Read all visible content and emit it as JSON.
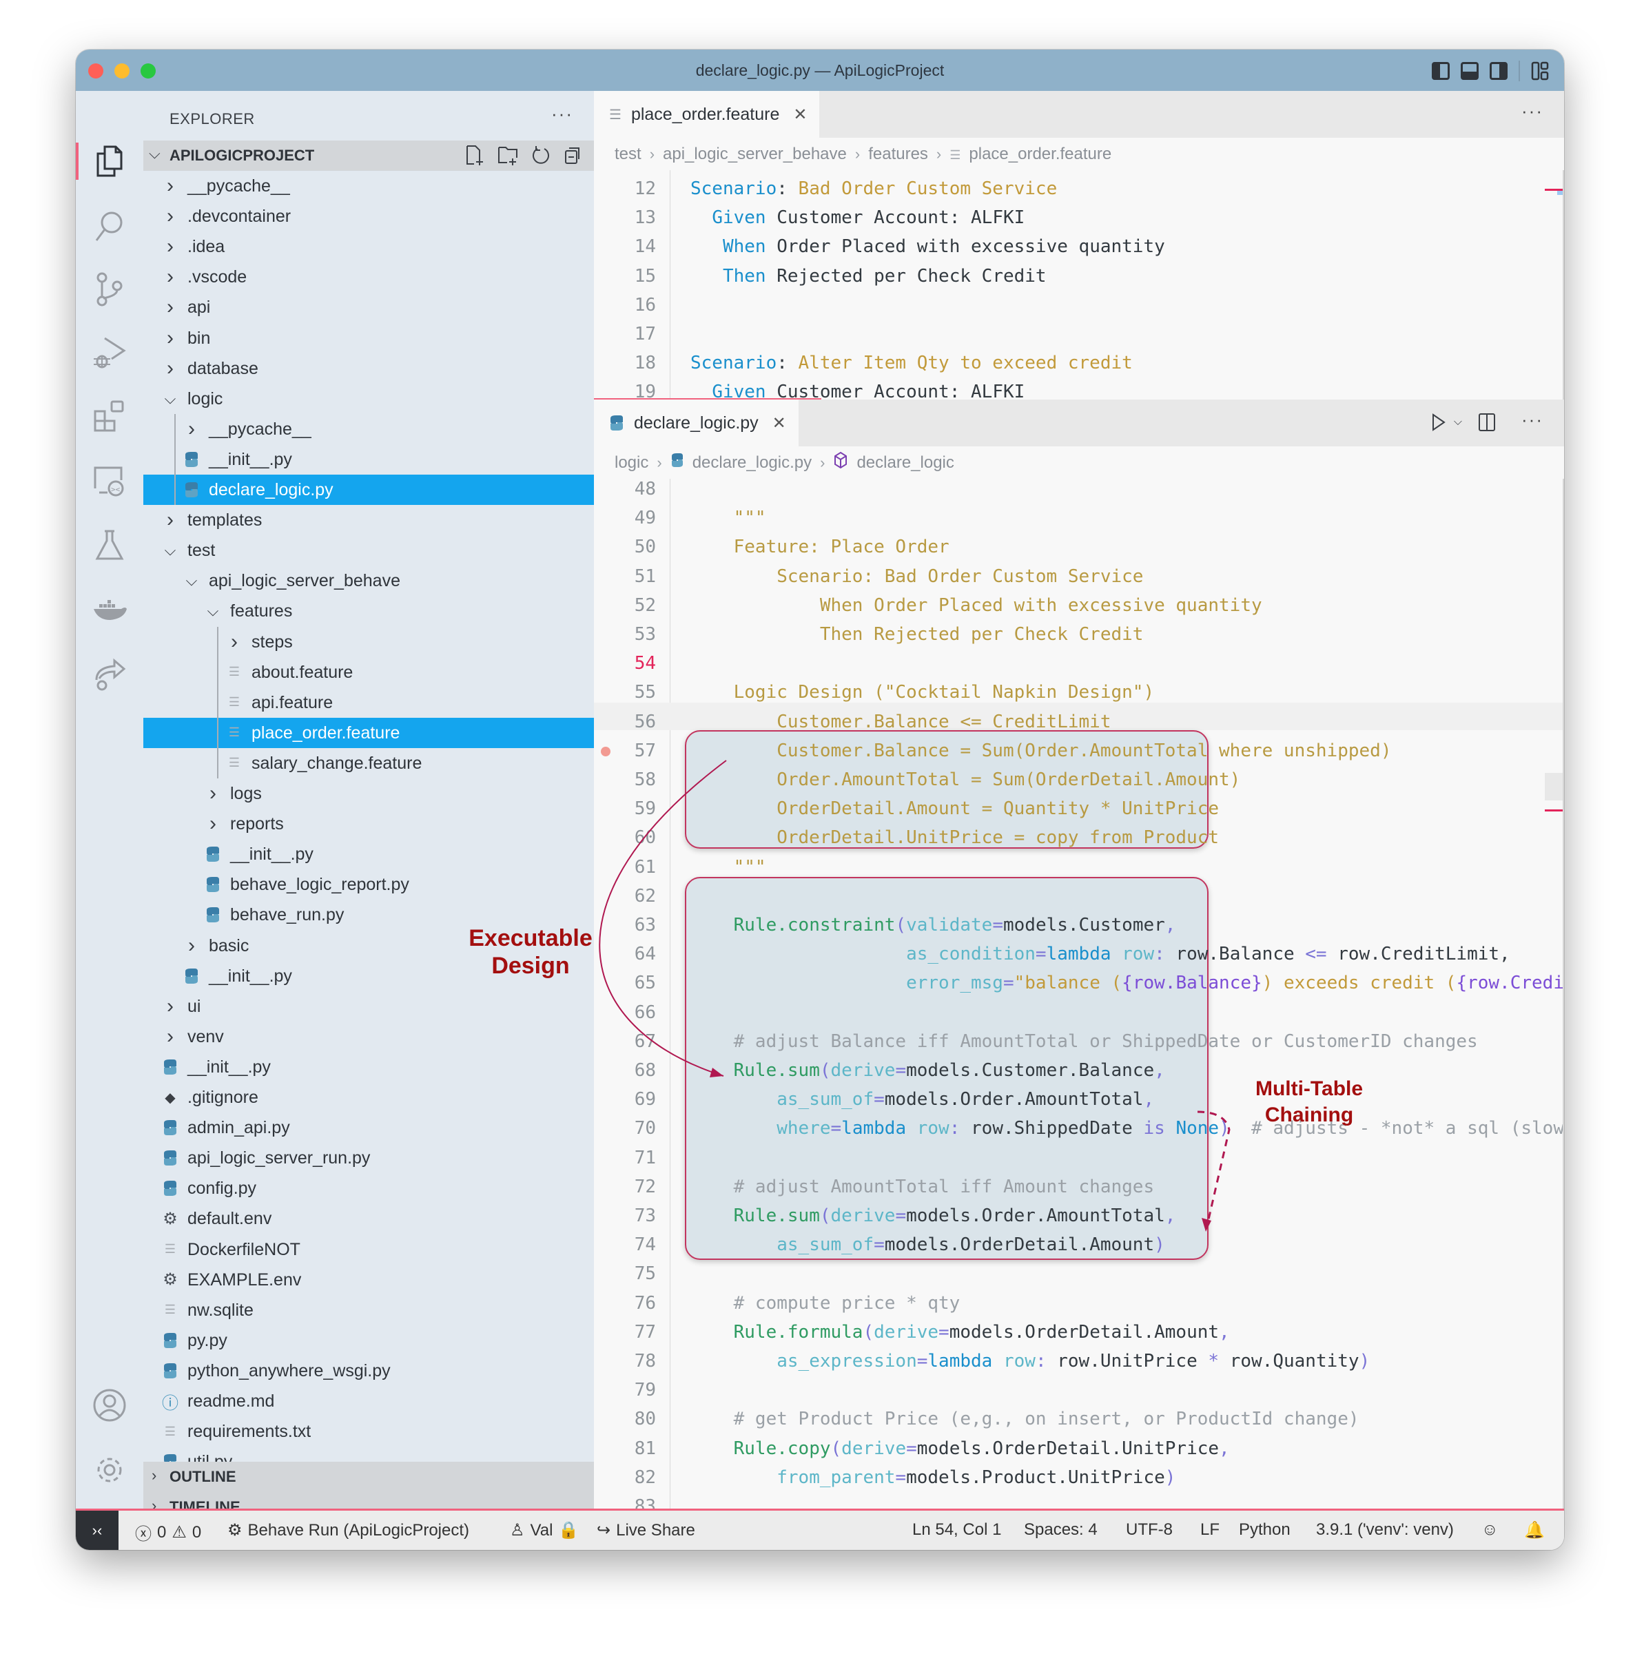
{
  "window": {
    "title": "declare_logic.py — ApiLogicProject",
    "traffic_lights": {
      "close": "#ff5f57",
      "minimize": "#febc2e",
      "zoom": "#28c840"
    },
    "accent_color": "#f0627e",
    "selection_color": "#14a5ee"
  },
  "activity_bar": {
    "items": [
      {
        "name": "explorer",
        "icon": "files-icon",
        "active": true
      },
      {
        "name": "search",
        "icon": "search-icon"
      },
      {
        "name": "source-control",
        "icon": "source-control-icon"
      },
      {
        "name": "run-debug",
        "icon": "run-debug-icon"
      },
      {
        "name": "extensions",
        "icon": "extensions-icon"
      },
      {
        "name": "remote-explorer",
        "icon": "remote-explorer-icon"
      },
      {
        "name": "testing",
        "icon": "flask-icon"
      },
      {
        "name": "docker",
        "icon": "docker-icon"
      },
      {
        "name": "live-share",
        "icon": "live-share-icon"
      }
    ],
    "bottom": [
      {
        "name": "accounts",
        "icon": "account-icon"
      },
      {
        "name": "manage",
        "icon": "gear-icon"
      }
    ]
  },
  "sidebar": {
    "title": "EXPLORER",
    "more": "···",
    "project": "APILOGICPROJECT",
    "tree": [
      {
        "label": "__pycache__",
        "depth": 0,
        "type": "folder",
        "expanded": false
      },
      {
        "label": ".devcontainer",
        "depth": 0,
        "type": "folder",
        "expanded": false
      },
      {
        "label": ".idea",
        "depth": 0,
        "type": "folder",
        "expanded": false
      },
      {
        "label": ".vscode",
        "depth": 0,
        "type": "folder",
        "expanded": false
      },
      {
        "label": "api",
        "depth": 0,
        "type": "folder",
        "expanded": false
      },
      {
        "label": "bin",
        "depth": 0,
        "type": "folder",
        "expanded": false
      },
      {
        "label": "database",
        "depth": 0,
        "type": "folder",
        "expanded": false
      },
      {
        "label": "logic",
        "depth": 0,
        "type": "folder",
        "expanded": true
      },
      {
        "label": "__pycache__",
        "depth": 1,
        "type": "folder",
        "expanded": false
      },
      {
        "label": "__init__.py",
        "depth": 1,
        "type": "python"
      },
      {
        "label": "declare_logic.py",
        "depth": 1,
        "type": "python",
        "selected": true
      },
      {
        "label": "templates",
        "depth": 0,
        "type": "folder",
        "expanded": false
      },
      {
        "label": "test",
        "depth": 0,
        "type": "folder",
        "expanded": true
      },
      {
        "label": "api_logic_server_behave",
        "depth": 1,
        "type": "folder",
        "expanded": true
      },
      {
        "label": "features",
        "depth": 2,
        "type": "folder",
        "expanded": true
      },
      {
        "label": "steps",
        "depth": 3,
        "type": "folder",
        "expanded": false
      },
      {
        "label": "about.feature",
        "depth": 3,
        "type": "text"
      },
      {
        "label": "api.feature",
        "depth": 3,
        "type": "text"
      },
      {
        "label": "place_order.feature",
        "depth": 3,
        "type": "text",
        "selected": true
      },
      {
        "label": "salary_change.feature",
        "depth": 3,
        "type": "text"
      },
      {
        "label": "logs",
        "depth": 2,
        "type": "folder",
        "expanded": false
      },
      {
        "label": "reports",
        "depth": 2,
        "type": "folder",
        "expanded": false
      },
      {
        "label": "__init__.py",
        "depth": 2,
        "type": "python"
      },
      {
        "label": "behave_logic_report.py",
        "depth": 2,
        "type": "python"
      },
      {
        "label": "behave_run.py",
        "depth": 2,
        "type": "python"
      },
      {
        "label": "basic",
        "depth": 1,
        "type": "folder",
        "expanded": false
      },
      {
        "label": "__init__.py",
        "depth": 1,
        "type": "python"
      },
      {
        "label": "ui",
        "depth": 0,
        "type": "folder",
        "expanded": false
      },
      {
        "label": "venv",
        "depth": 0,
        "type": "folder",
        "expanded": false
      },
      {
        "label": "__init__.py",
        "depth": 0,
        "type": "python"
      },
      {
        "label": ".gitignore",
        "depth": 0,
        "type": "git"
      },
      {
        "label": "admin_api.py",
        "depth": 0,
        "type": "python"
      },
      {
        "label": "api_logic_server_run.py",
        "depth": 0,
        "type": "python"
      },
      {
        "label": "config.py",
        "depth": 0,
        "type": "python"
      },
      {
        "label": "default.env",
        "depth": 0,
        "type": "settings"
      },
      {
        "label": "DockerfileNOT",
        "depth": 0,
        "type": "text"
      },
      {
        "label": "EXAMPLE.env",
        "depth": 0,
        "type": "settings"
      },
      {
        "label": "nw.sqlite",
        "depth": 0,
        "type": "text"
      },
      {
        "label": "py.py",
        "depth": 0,
        "type": "python"
      },
      {
        "label": "python_anywhere_wsgi.py",
        "depth": 0,
        "type": "python"
      },
      {
        "label": "readme.md",
        "depth": 0,
        "type": "info"
      },
      {
        "label": "requirements.txt",
        "depth": 0,
        "type": "text"
      },
      {
        "label": "util.py",
        "depth": 0,
        "type": "python"
      }
    ],
    "panels": [
      "OUTLINE",
      "TIMELINE"
    ]
  },
  "editor_top": {
    "tab": "place_order.feature",
    "more": "···",
    "breadcrumb": [
      "test",
      "api_logic_server_behave",
      "features",
      "place_order.feature"
    ],
    "lines": [
      {
        "n": 12,
        "tokens": [
          [
            "kw",
            "Scenario"
          ],
          [
            "plain",
            ": "
          ],
          [
            "str",
            "Bad Order Custom Service"
          ]
        ]
      },
      {
        "n": 13,
        "tokens": [
          [
            "plain",
            "  "
          ],
          [
            "kw",
            "Given"
          ],
          [
            "plain",
            " Customer Account: ALFKI"
          ]
        ]
      },
      {
        "n": 14,
        "tokens": [
          [
            "plain",
            "   "
          ],
          [
            "kw",
            "When"
          ],
          [
            "plain",
            " Order Placed with excessive quantity"
          ]
        ]
      },
      {
        "n": 15,
        "tokens": [
          [
            "plain",
            "   "
          ],
          [
            "kw",
            "Then"
          ],
          [
            "plain",
            " Rejected per Check Credit"
          ]
        ]
      },
      {
        "n": 16,
        "tokens": []
      },
      {
        "n": 17,
        "tokens": []
      },
      {
        "n": 18,
        "tokens": [
          [
            "kw",
            "Scenario"
          ],
          [
            "plain",
            ": "
          ],
          [
            "str",
            "Alter Item Qty to exceed credit"
          ]
        ]
      },
      {
        "n": 19,
        "tokens": [
          [
            "plain",
            "  "
          ],
          [
            "kw",
            "Given"
          ],
          [
            "plain",
            " Customer Account: ALFKI"
          ]
        ]
      }
    ]
  },
  "editor_bottom": {
    "tab": "declare_logic.py",
    "breadcrumb": [
      "logic",
      "declare_logic.py",
      "declare_logic"
    ],
    "current_line": 54,
    "breakpoint_line": 57,
    "lines": [
      {
        "n": 48,
        "tokens": []
      },
      {
        "n": 49,
        "tokens": [
          [
            "doc",
            "    \"\"\""
          ]
        ]
      },
      {
        "n": 50,
        "tokens": [
          [
            "doc",
            "    Feature: Place Order"
          ]
        ]
      },
      {
        "n": 51,
        "tokens": [
          [
            "doc",
            "        Scenario: Bad Order Custom Service"
          ]
        ]
      },
      {
        "n": 52,
        "tokens": [
          [
            "doc",
            "            When Order Placed with excessive quantity"
          ]
        ]
      },
      {
        "n": 53,
        "tokens": [
          [
            "doc",
            "            Then Rejected per Check Credit"
          ]
        ]
      },
      {
        "n": 54,
        "tokens": []
      },
      {
        "n": 55,
        "tokens": [
          [
            "doc",
            "    Logic Design (\"Cocktail Napkin Design\")"
          ]
        ]
      },
      {
        "n": 56,
        "tokens": [
          [
            "doc",
            "        Customer.Balance <= CreditLimit"
          ]
        ]
      },
      {
        "n": 57,
        "tokens": [
          [
            "doc",
            "        Customer.Balance = Sum(Order.AmountTotal where unshipped)"
          ]
        ]
      },
      {
        "n": 58,
        "tokens": [
          [
            "doc",
            "        Order.AmountTotal = Sum(OrderDetail.Amount)"
          ]
        ]
      },
      {
        "n": 59,
        "tokens": [
          [
            "doc",
            "        OrderDetail.Amount = Quantity * UnitPrice"
          ]
        ]
      },
      {
        "n": 60,
        "tokens": [
          [
            "doc",
            "        OrderDetail.UnitPrice = copy from Product"
          ]
        ]
      },
      {
        "n": 61,
        "tokens": [
          [
            "doc",
            "    \"\"\""
          ]
        ]
      },
      {
        "n": 62,
        "tokens": []
      },
      {
        "n": 63,
        "tokens": [
          [
            "plain",
            "    "
          ],
          [
            "fn",
            "Rule.constraint"
          ],
          [
            "op",
            "("
          ],
          [
            "par",
            "validate"
          ],
          [
            "op",
            "="
          ],
          [
            "plain",
            "models.Customer"
          ],
          [
            "op",
            ","
          ]
        ]
      },
      {
        "n": 64,
        "tokens": [
          [
            "plain",
            "                    "
          ],
          [
            "par",
            "as_condition"
          ],
          [
            "op",
            "="
          ],
          [
            "kw",
            "lambda"
          ],
          [
            "par",
            " row"
          ],
          [
            "op",
            ":"
          ],
          [
            "plain",
            " row.Balance "
          ],
          [
            "op",
            "<="
          ],
          [
            "plain",
            " row.CreditLimit,"
          ]
        ]
      },
      {
        "n": 65,
        "tokens": [
          [
            "plain",
            "                    "
          ],
          [
            "par",
            "error_msg"
          ],
          [
            "op",
            "="
          ],
          [
            "str",
            "\"balance ("
          ],
          [
            "var",
            "{row.Balance}"
          ],
          [
            "str",
            ") exceeds credit ("
          ],
          [
            "var",
            "{row.CreditLimit}"
          ],
          [
            "str",
            ")\")"
          ]
        ]
      },
      {
        "n": 66,
        "tokens": []
      },
      {
        "n": 67,
        "tokens": [
          [
            "cmt",
            "    # adjust Balance iff AmountTotal or ShippedDate or CustomerID changes"
          ]
        ]
      },
      {
        "n": 68,
        "tokens": [
          [
            "plain",
            "    "
          ],
          [
            "fn",
            "Rule.sum"
          ],
          [
            "op",
            "("
          ],
          [
            "par",
            "derive"
          ],
          [
            "op",
            "="
          ],
          [
            "plain",
            "models.Customer.Balance"
          ],
          [
            "op",
            ","
          ]
        ]
      },
      {
        "n": 69,
        "tokens": [
          [
            "plain",
            "        "
          ],
          [
            "par",
            "as_sum_of"
          ],
          [
            "op",
            "="
          ],
          [
            "plain",
            "models.Order.AmountTotal"
          ],
          [
            "op",
            ","
          ]
        ]
      },
      {
        "n": 70,
        "tokens": [
          [
            "plain",
            "        "
          ],
          [
            "par",
            "where"
          ],
          [
            "op",
            "="
          ],
          [
            "kw",
            "lambda"
          ],
          [
            "par",
            " row"
          ],
          [
            "op",
            ":"
          ],
          [
            "plain",
            " row.ShippedDate "
          ],
          [
            "op",
            "is"
          ],
          [
            "kw",
            " None"
          ],
          [
            "op",
            ")"
          ],
          [
            "cmt",
            "  # adjusts - *not* a sql (slow) sum"
          ]
        ]
      },
      {
        "n": 71,
        "tokens": []
      },
      {
        "n": 72,
        "tokens": [
          [
            "cmt",
            "    # adjust AmountTotal iff Amount changes"
          ]
        ]
      },
      {
        "n": 73,
        "tokens": [
          [
            "plain",
            "    "
          ],
          [
            "fn",
            "Rule.sum"
          ],
          [
            "op",
            "("
          ],
          [
            "par",
            "derive"
          ],
          [
            "op",
            "="
          ],
          [
            "plain",
            "models.Order.AmountTotal"
          ],
          [
            "op",
            ","
          ]
        ]
      },
      {
        "n": 74,
        "tokens": [
          [
            "plain",
            "        "
          ],
          [
            "par",
            "as_sum_of"
          ],
          [
            "op",
            "="
          ],
          [
            "plain",
            "models.OrderDetail.Amount"
          ],
          [
            "op",
            ")"
          ]
        ]
      },
      {
        "n": 75,
        "tokens": []
      },
      {
        "n": 76,
        "tokens": [
          [
            "cmt",
            "    # compute price * qty"
          ]
        ]
      },
      {
        "n": 77,
        "tokens": [
          [
            "plain",
            "    "
          ],
          [
            "fn",
            "Rule.formula"
          ],
          [
            "op",
            "("
          ],
          [
            "par",
            "derive"
          ],
          [
            "op",
            "="
          ],
          [
            "plain",
            "models.OrderDetail.Amount"
          ],
          [
            "op",
            ","
          ]
        ]
      },
      {
        "n": 78,
        "tokens": [
          [
            "plain",
            "        "
          ],
          [
            "par",
            "as_expression"
          ],
          [
            "op",
            "="
          ],
          [
            "kw",
            "lambda"
          ],
          [
            "par",
            " row"
          ],
          [
            "op",
            ":"
          ],
          [
            "plain",
            " row.UnitPrice "
          ],
          [
            "op",
            "*"
          ],
          [
            "plain",
            " row.Quantity"
          ],
          [
            "op",
            ")"
          ]
        ]
      },
      {
        "n": 79,
        "tokens": []
      },
      {
        "n": 80,
        "tokens": [
          [
            "cmt",
            "    # get Product Price (e,g., on insert, or ProductId change)"
          ]
        ]
      },
      {
        "n": 81,
        "tokens": [
          [
            "plain",
            "    "
          ],
          [
            "fn",
            "Rule.copy"
          ],
          [
            "op",
            "("
          ],
          [
            "par",
            "derive"
          ],
          [
            "op",
            "="
          ],
          [
            "plain",
            "models.OrderDetail.UnitPrice"
          ],
          [
            "op",
            ","
          ]
        ]
      },
      {
        "n": 82,
        "tokens": [
          [
            "plain",
            "        "
          ],
          [
            "par",
            "from_parent"
          ],
          [
            "op",
            "="
          ],
          [
            "plain",
            "models.Product.UnitPrice"
          ],
          [
            "op",
            ")"
          ]
        ]
      },
      {
        "n": 83,
        "tokens": []
      }
    ]
  },
  "annotations": {
    "executable_design": [
      "Executable",
      "Design"
    ],
    "multi_table_chaining": [
      "Multi-Table",
      "Chaining"
    ],
    "color": "#a30f0f"
  },
  "statusbar": {
    "errors": "0",
    "warnings": "0",
    "run_config": "Behave Run (ApiLogicProject)",
    "user": "Val",
    "live_share": "Live Share",
    "cursor": "Ln 54, Col 1",
    "indent": "Spaces: 4",
    "encoding": "UTF-8",
    "eol": "LF",
    "language": "Python",
    "interpreter": "3.9.1 ('venv': venv)"
  }
}
